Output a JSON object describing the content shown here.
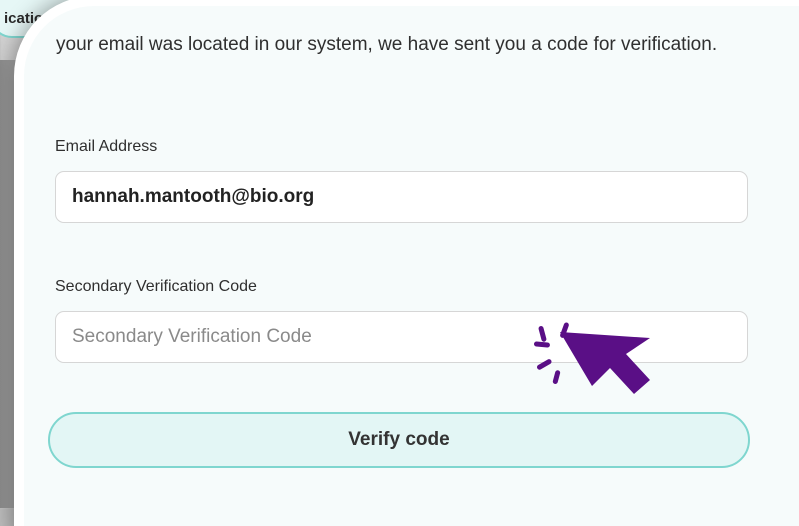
{
  "background": {
    "tab_label": "ication Co"
  },
  "form": {
    "intro_text": "your email was located in our system, we have sent you a code for verification.",
    "email_label": "Email Address",
    "email_value": "hannah.mantooth@bio.org",
    "code_label": "Secondary Verification Code",
    "code_placeholder": "Secondary Verification Code",
    "code_value": "",
    "verify_button_label": "Verify code"
  },
  "colors": {
    "accent_border": "#7fd6cf",
    "button_fill": "#e3f6f5",
    "cursor_color": "#5a0f86"
  },
  "icons": {
    "pointer": "click-cursor-icon"
  }
}
